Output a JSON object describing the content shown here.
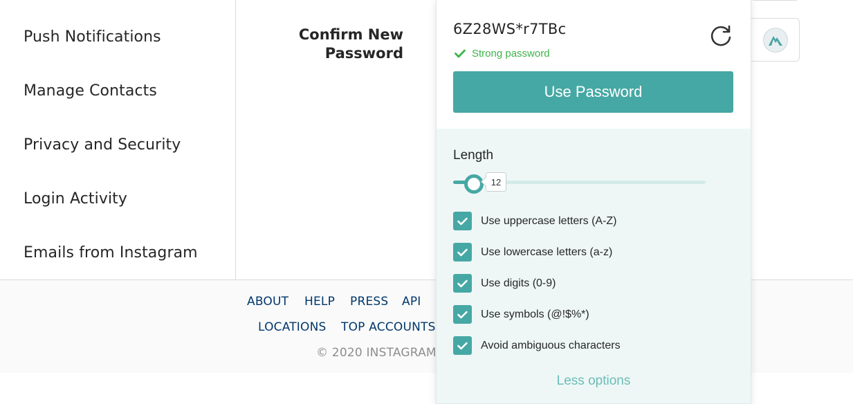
{
  "sidebar": {
    "items": [
      {
        "label": "Push Notifications"
      },
      {
        "label": "Manage Contacts"
      },
      {
        "label": "Privacy and Security"
      },
      {
        "label": "Login Activity"
      },
      {
        "label": "Emails from Instagram"
      }
    ]
  },
  "form": {
    "confirm_label_line1": "Confirm New",
    "confirm_label_line2": "Password",
    "manager_icon": "nordpass-mountain-icon"
  },
  "footer": {
    "links_row1": [
      "ABOUT",
      "HELP",
      "PRESS",
      "API"
    ],
    "links_row2": [
      "LOCATIONS",
      "TOP ACCOUNTS"
    ],
    "copyright": "© 2020 INSTAGRAM"
  },
  "generator": {
    "password": "6Z28WS*r7TBc",
    "strength": "Strong password",
    "use_button": "Use Password",
    "length_label": "Length",
    "length_value": "12",
    "options": [
      {
        "label": "Use uppercase letters (A-Z)",
        "checked": true
      },
      {
        "label": "Use lowercase letters (a-z)",
        "checked": true
      },
      {
        "label": "Use digits (0-9)",
        "checked": true
      },
      {
        "label": "Use symbols (@!$%*)",
        "checked": true
      },
      {
        "label": "Avoid ambiguous characters",
        "checked": true
      }
    ],
    "less_options": "Less options",
    "icons": {
      "refresh": "refresh-icon",
      "strength": "checkmark-icon"
    }
  },
  "colors": {
    "accent": "#46a8a4",
    "strong": "#3cb44a",
    "link": "#00376b",
    "panel": "#eef7f6"
  }
}
